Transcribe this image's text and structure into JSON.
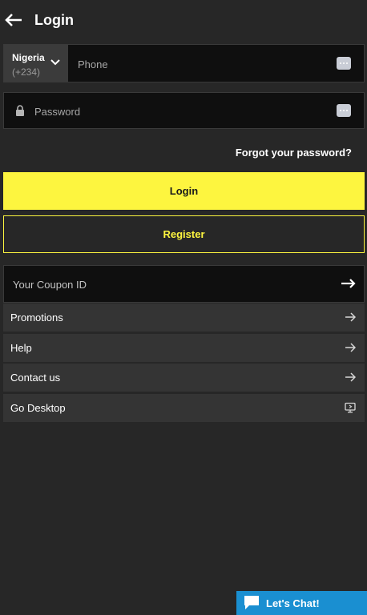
{
  "header": {
    "title": "Login",
    "back_icon": "arrow-left-icon"
  },
  "phone": {
    "country_name": "Nigeria",
    "country_code": "(+234)",
    "placeholder": "Phone",
    "keyboard_icon": "keyboard-dots-icon"
  },
  "password": {
    "placeholder": "Password",
    "lock_icon": "lock-icon",
    "keyboard_icon": "keyboard-dots-icon"
  },
  "forgot_label": "Forgot your password?",
  "login_label": "Login",
  "register_label": "Register",
  "coupon": {
    "placeholder": "Your Coupon ID",
    "arrow_icon": "arrow-right-icon"
  },
  "menu": [
    {
      "label": "Promotions",
      "icon": "arrow-right-icon"
    },
    {
      "label": "Help",
      "icon": "arrow-right-icon"
    },
    {
      "label": "Contact us",
      "icon": "arrow-right-icon"
    },
    {
      "label": "Go Desktop",
      "icon": "desktop-icon"
    }
  ],
  "chat": {
    "label": "Let's Chat!",
    "icon": "chat-bubble-icon"
  },
  "colors": {
    "accent": "#fdf53f",
    "background": "#272727",
    "field": "#0f0f0f",
    "menu_row": "#343434",
    "chat": "#1a8fd1"
  }
}
